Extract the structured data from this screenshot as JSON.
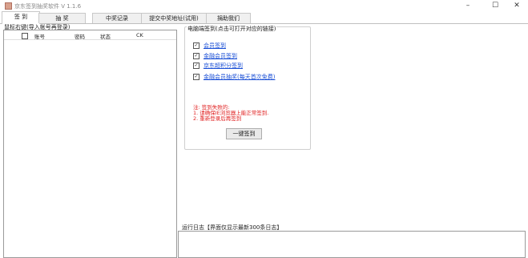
{
  "window": {
    "title": "京东签到抽奖软件 V 1.1.6",
    "controls": {
      "minimize": "–",
      "maximize": "☐",
      "close": "✕"
    }
  },
  "tabs": [
    {
      "label": "签  到",
      "active": true
    },
    {
      "label": "抽  奖",
      "active": false
    },
    {
      "label": "中奖记录",
      "active": false
    },
    {
      "label": "提交中奖地址(试用)",
      "active": false
    },
    {
      "label": "捐助我们",
      "active": false
    }
  ],
  "accounts": {
    "hint": "鼠标右键(导入帐号再登录)",
    "columns": {
      "account": "账号",
      "password": "密码",
      "status": "状态",
      "ck": "CK"
    }
  },
  "signin": {
    "group_title": "电脑端签到(点击可打开对应的链接)",
    "options": [
      {
        "label": "会员签到",
        "checked": true
      },
      {
        "label": "金融会员签到",
        "checked": true
      },
      {
        "label": "京东超积分签到",
        "checked": true
      },
      {
        "label": "金融会员抽奖(每天首次免费)",
        "checked": true
      }
    ],
    "notes": [
      "注: 签到失败的:",
      "1. 请确保IE浏览器上能正常签到.",
      "2. 重新登录后再签到"
    ],
    "button": "一键签到"
  },
  "log": {
    "label": "运行日志【界面仅显示最新300条日志】"
  },
  "colors": {
    "link": "#1a4fd6",
    "warning": "#e02020",
    "border": "#9a9a9a"
  }
}
